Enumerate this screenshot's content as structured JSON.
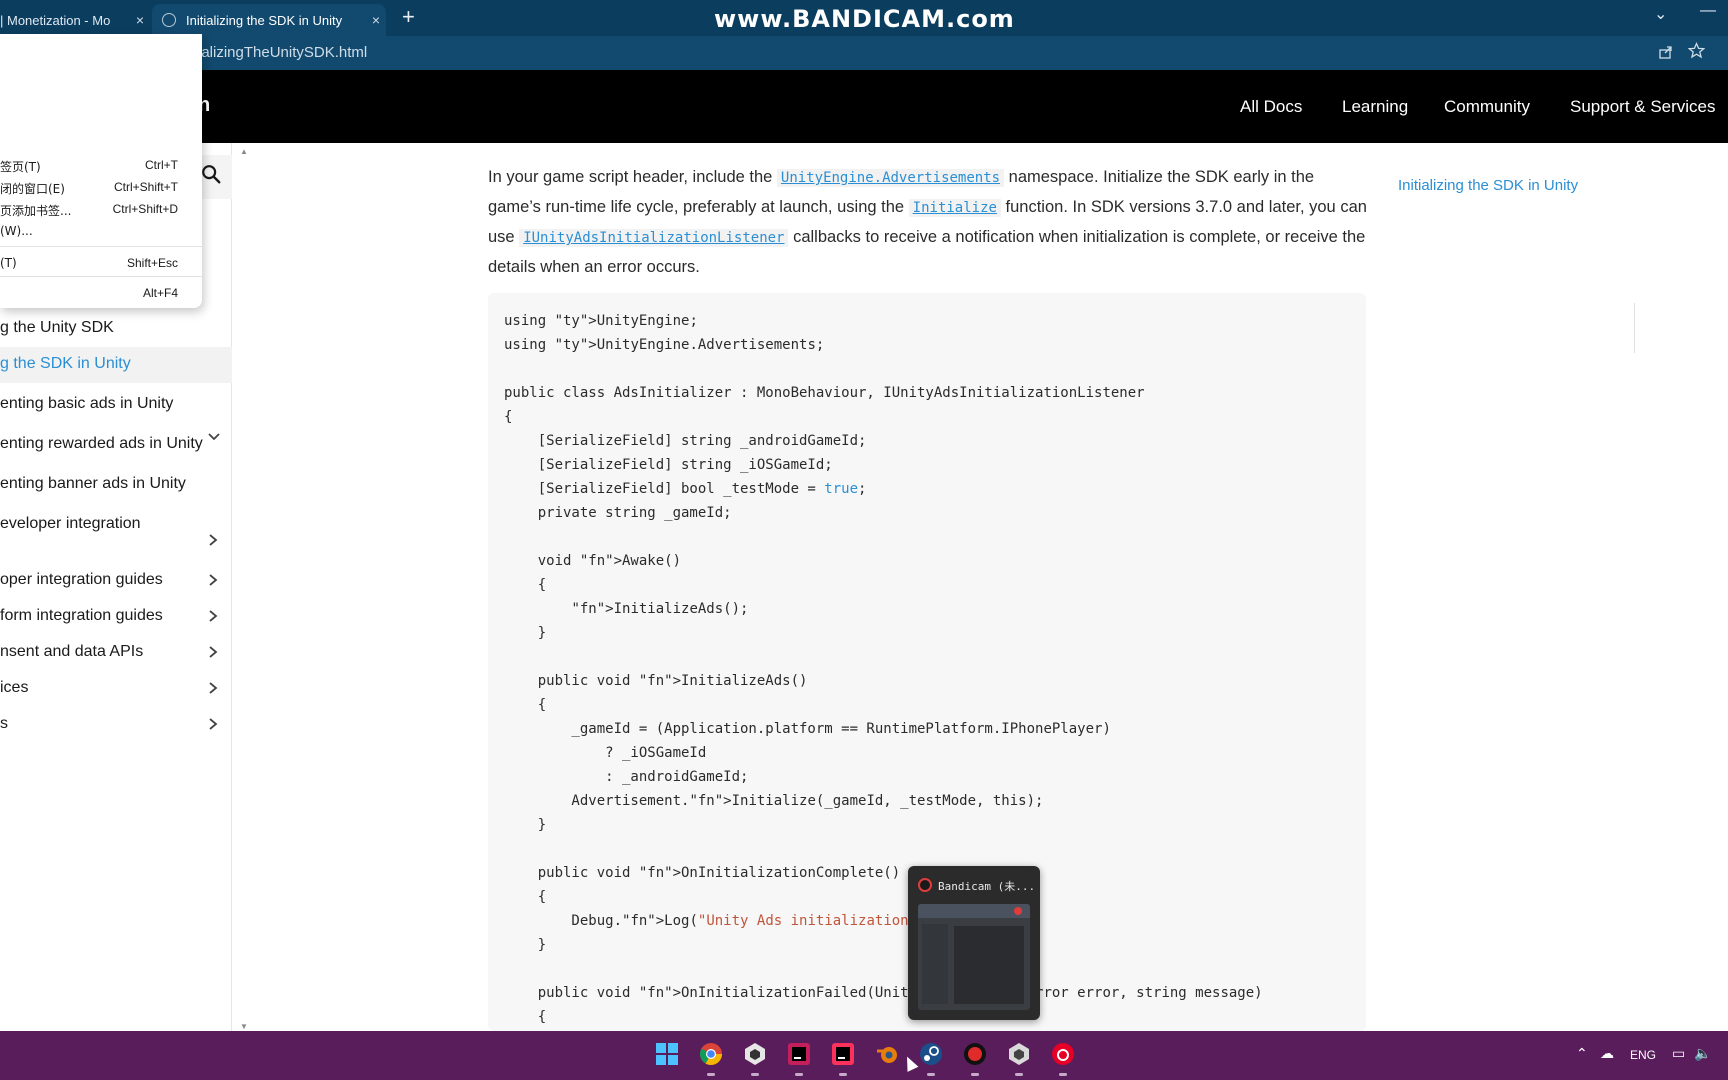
{
  "browser": {
    "tabs": [
      {
        "label": "| Monetization - Mo",
        "close": "×"
      },
      {
        "label": "Initializing the SDK in Unity",
        "close": "×"
      }
    ],
    "new_tab": "+",
    "watermark": "www.BANDICAM.com",
    "url": "ializingTheUnitySDK.html",
    "tab_menu_glyph": "⌄",
    "minimize_glyph": "—"
  },
  "site": {
    "logo_fragment": "n",
    "nav": [
      "All Docs",
      "Learning",
      "Community",
      "Support & Services"
    ]
  },
  "context_menu": {
    "items": [
      {
        "label": "签页(T)",
        "key": "Ctrl+T"
      },
      {
        "label": "闭的窗口(E)",
        "key": "Ctrl+Shift+T"
      },
      {
        "label": "页添加书签...",
        "key": "Ctrl+Shift+D"
      },
      {
        "label": "(W)...",
        "key": ""
      },
      {
        "label": "(T)",
        "key": "Shift+Esc"
      },
      {
        "label": "",
        "key": "Alt+F4"
      }
    ]
  },
  "sidebar": {
    "items": [
      {
        "label": "g the Unity SDK",
        "active": false,
        "chevron": false
      },
      {
        "label": "g the SDK in Unity",
        "active": true,
        "chevron": false
      },
      {
        "label": "enting basic ads in Unity",
        "active": false,
        "chevron": false
      },
      {
        "label": "enting rewarded ads in Unity",
        "active": false,
        "chevron": false
      },
      {
        "label": "enting banner ads in Unity",
        "active": false,
        "chevron": false
      },
      {
        "label": "eveloper integration",
        "active": false,
        "chevron": true
      },
      {
        "label": "oper integration guides",
        "active": false,
        "chevron": true
      },
      {
        "label": "form integration guides",
        "active": false,
        "chevron": true
      },
      {
        "label": "nsent and data APIs",
        "active": false,
        "chevron": true
      },
      {
        "label": "ices",
        "active": false,
        "chevron": true
      },
      {
        "label": "s",
        "active": false,
        "chevron": true
      }
    ]
  },
  "content": {
    "intro": {
      "p1": "In your game script header, include the ",
      "link1": "UnityEngine.Advertisements",
      "p2": " namespace. Initialize the SDK early in the game’s run-time life cycle, preferably at launch, using the ",
      "link2": "Initialize",
      "p3": " function. In SDK versions 3.7.0 and later, you can use ",
      "link3": "IUnityAdsInitializationListener",
      "p4": " callbacks to receive a notification when initialization is complete, or receive the details when an error occurs."
    },
    "code": [
      "using UnityEngine;",
      "using UnityEngine.Advertisements;",
      "",
      "public class AdsInitializer : MonoBehaviour, IUnityAdsInitializationListener",
      "{",
      "    [SerializeField] string _androidGameId;",
      "    [SerializeField] string _iOSGameId;",
      "    [SerializeField] bool _testMode = true;",
      "    private string _gameId;",
      "",
      "    void Awake()",
      "    {",
      "        InitializeAds();",
      "    }",
      "",
      "    public void InitializeAds()",
      "    {",
      "        _gameId = (Application.platform == RuntimePlatform.IPhonePlayer)",
      "            ? _iOSGameId",
      "            : _androidGameId;",
      "        Advertisement.Initialize(_gameId, _testMode, this);",
      "    }",
      "",
      "    public void OnInitializationComplete()",
      "    {",
      "        Debug.Log(\"Unity Ads initialization co",
      "    }",
      "",
      "    public void OnInitializationFailed(UnityAd           Error error, string message)",
      "    {"
    ],
    "toc": "Initializing the SDK in Unity"
  },
  "bandicam": {
    "title": "Bandicam (未..."
  },
  "taskbar": {
    "apps": [
      "start-icon",
      "chrome-icon",
      "unity-hub-icon",
      "rider-icon",
      "intellij-icon",
      "blender-icon",
      "steam-icon",
      "bandicam-icon",
      "unity-icon",
      "netease-music-icon"
    ],
    "lang": "ENG"
  },
  "colors": {
    "tabstrip": "#0b3d5e",
    "addressbar": "#12496e",
    "header": "#000000",
    "link": "#2a8fd4",
    "taskbar": "#5a1d5c"
  }
}
